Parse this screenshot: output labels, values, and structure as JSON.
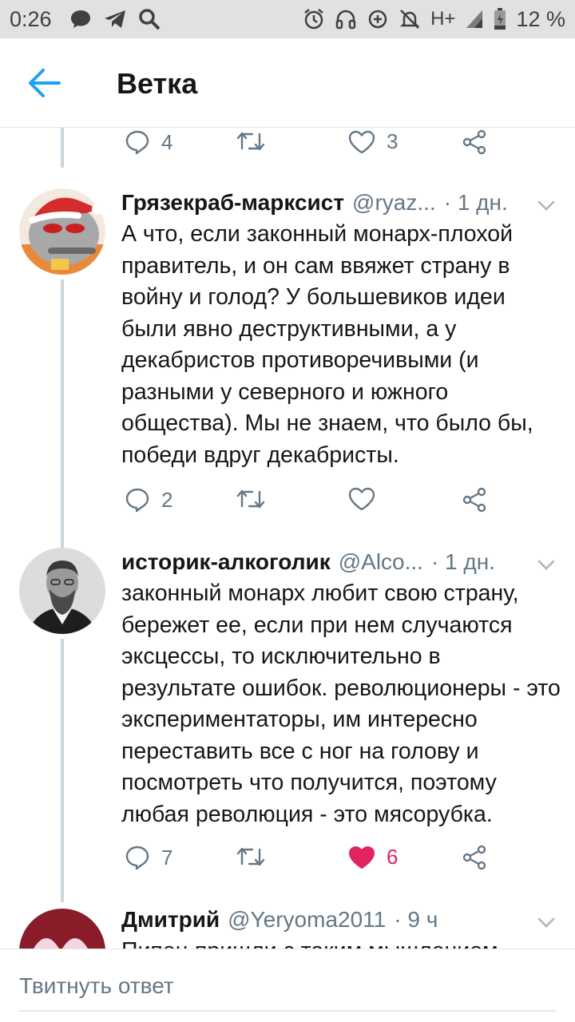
{
  "status_bar": {
    "time": "0:26",
    "network": "H+",
    "battery": "12 %",
    "icons": [
      "chat-bubble-icon",
      "telegram-icon",
      "search-icon",
      "alarm-icon",
      "headphones-icon",
      "data-saver-icon",
      "mute-icon",
      "signal-icon",
      "battery-icon"
    ]
  },
  "header": {
    "title": "Ветка",
    "back_icon": "arrow-left-icon"
  },
  "colors": {
    "accent": "#1da1f2",
    "like": "#e0245e",
    "muted": "#657786",
    "thread_line": "#ccd6dd"
  },
  "top_actions": {
    "replies": "4",
    "retweets": "",
    "likes": "3"
  },
  "tweets": [
    {
      "author": "Грязекраб-марксист",
      "handle": "@ryaz...",
      "time": "· 1 дн.",
      "text": "А что, если законный монарх-плохой правитель, и он сам ввяжет страну в войну и голод? У большевиков идеи были явно деструктивными, а у декабристов противоречивыми (и разными у северного и южного общества). Мы не знаем, что было бы, победи вдруг декабристы.",
      "replies": "2",
      "retweets": "",
      "likes": "",
      "liked": false
    },
    {
      "author": "историк-алкоголик",
      "handle": "@Alco...",
      "time": "· 1 дн.",
      "text": "законный монарх любит свою страну, бережет ее, если при нем случаются эксцессы, то исключительно в результате ошибок. революционеры - это экспериментаторы, им интересно переставить все с ног на голову и посмотреть что получится, поэтому любая революция - это мясорубка.",
      "replies": "7",
      "retweets": "",
      "likes": "6",
      "liked": true
    },
    {
      "author": "Дмитрий",
      "handle": "@Yeryoma2011",
      "time": "· 9 ч",
      "text": "Пипец пришли с таким мышлением"
    }
  ],
  "reply_bar": {
    "placeholder": "Твитнуть ответ"
  }
}
